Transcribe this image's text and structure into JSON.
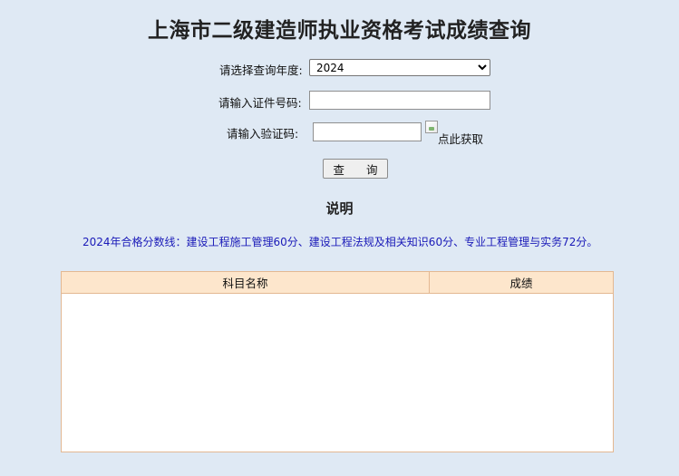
{
  "title": "上海市二级建造师执业资格考试成绩查询",
  "form": {
    "year_label": "请选择查询年度:",
    "year_selected": "2024",
    "id_label": "请输入证件号码:",
    "id_value": "",
    "captcha_label": "请输入验证码:",
    "captcha_value": "",
    "captcha_image_alt": "点此获取",
    "query_button": "查 询"
  },
  "notes": {
    "heading": "说明",
    "text": "2024年合格分数线：建设工程施工管理60分、建设工程法规及相关知识60分、专业工程管理与实务72分。"
  },
  "results_table": {
    "columns": [
      "科目名称",
      "成绩"
    ],
    "rows": []
  },
  "colors": {
    "background": "#dfe9f4",
    "table_header_bg": "#fde6cc",
    "table_border": "#e3b892",
    "notice_text": "#1a1ab8"
  }
}
